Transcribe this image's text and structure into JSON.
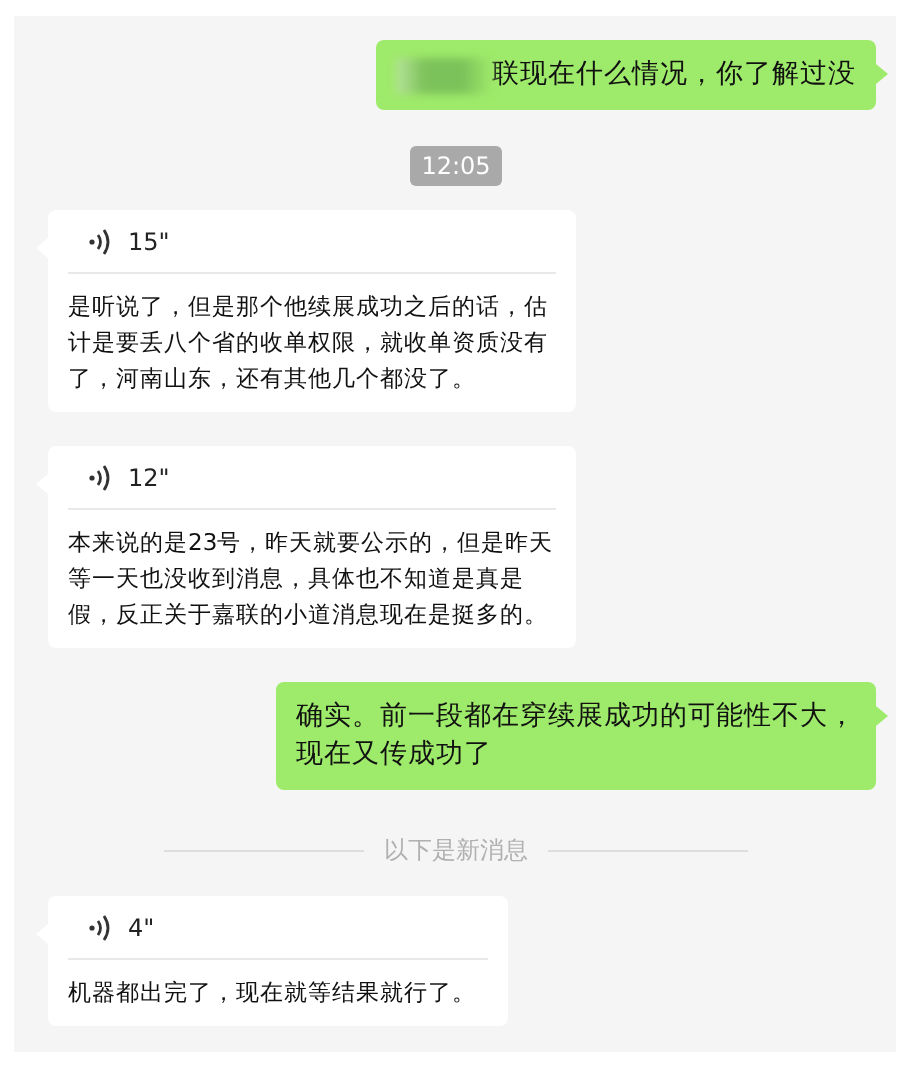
{
  "messages": [
    {
      "kind": "text_out",
      "redacted": true,
      "text": "联现在什么情况，你了解过没"
    },
    {
      "kind": "time",
      "text": "12:05"
    },
    {
      "kind": "voice_in",
      "duration": "15\"",
      "text": "是听说了，但是那个他续展成功之后的话，估计是要丢八个省的收单权限，就收单资质没有了，河南山东，还有其他几个都没了。"
    },
    {
      "kind": "voice_in",
      "duration": "12\"",
      "text": "本来说的是23号，昨天就要公示的，但是昨天等一天也没收到消息，具体也不知道是真是假，反正关于嘉联的小道消息现在是挺多的。"
    },
    {
      "kind": "text_out",
      "redacted": false,
      "text": "确实。前一段都在穿续展成功的可能性不大，现在又传成功了"
    },
    {
      "kind": "divider",
      "text": "以下是新消息"
    },
    {
      "kind": "voice_in",
      "duration": "4\"",
      "text": "机器都出完了，现在就等结果就行了。"
    }
  ]
}
